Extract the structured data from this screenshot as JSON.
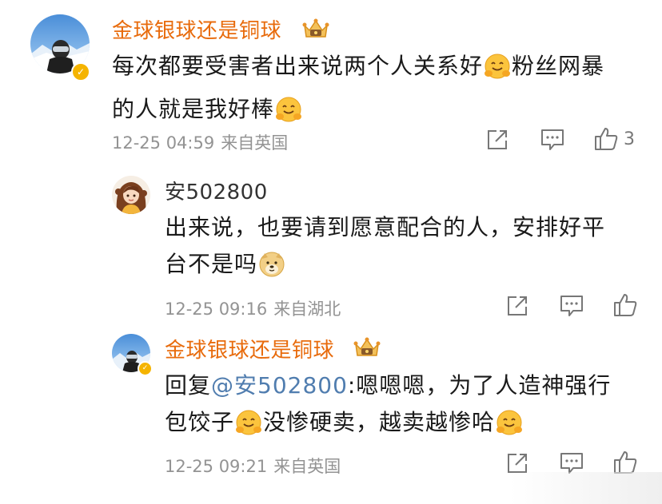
{
  "comments": [
    {
      "username": "金球银球还是铜球",
      "text_parts": [
        "每次都要受害者出来说两个人关系好",
        "粉丝网暴",
        "的人就是我好棒",
        ""
      ],
      "timestamp": "12-25 04:59",
      "location": "来自英国",
      "like_count": "3",
      "username_color": "#e86b0c"
    },
    {
      "username": "安502800",
      "text_parts": [
        "出来说，也要请到愿意配合的人，安排好平",
        "台不是吗",
        ""
      ],
      "timestamp": "12-25 09:16",
      "location": "来自湖北"
    },
    {
      "username": "金球银球还是铜球",
      "reply_prefix": "回复",
      "mention": "@安502800",
      "text_parts": [
        ":嗯嗯嗯，为了人造神强行",
        "包饺子",
        "没惨硬卖，越卖越惨哈",
        ""
      ],
      "timestamp": "12-25 09:21",
      "location": "来自英国"
    }
  ],
  "icons": {
    "share": "share-icon",
    "comment": "comment-icon",
    "like": "like-icon",
    "crown": "crown-badge-icon",
    "verified": "verified-badge-icon",
    "emoji_hug": "hug-emoji-icon",
    "emoji_doge": "doge-emoji-icon"
  },
  "colors": {
    "username_orange": "#e86b0c",
    "mention_blue": "#507daf",
    "meta_gray": "#939393",
    "verified_gold": "#f5b400"
  }
}
